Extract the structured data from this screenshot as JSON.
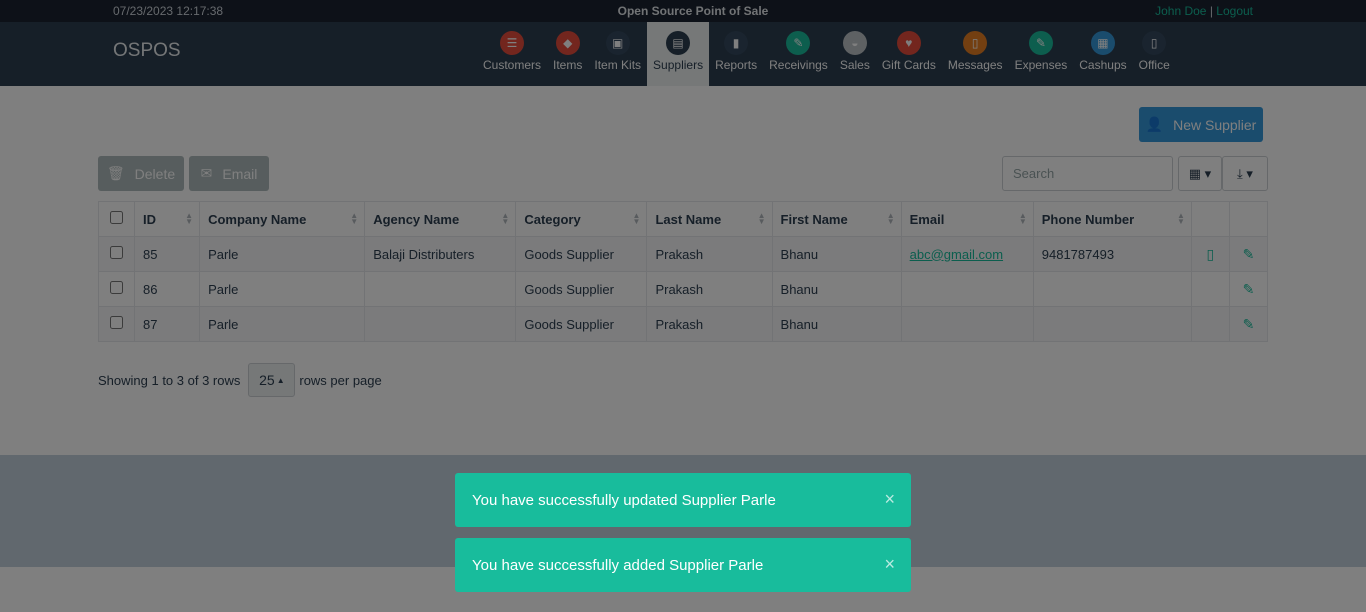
{
  "topbar": {
    "datetime": "07/23/2023 12:17:38",
    "app_title": "Open Source Point of Sale",
    "user": "John Doe",
    "separator": "|",
    "logout": "Logout"
  },
  "brand": "OSPOS",
  "nav": [
    {
      "label": "Customers",
      "icon": "customers-icon",
      "color": "#e74c3c",
      "glyph": "☰"
    },
    {
      "label": "Items",
      "icon": "items-tag-icon",
      "color": "#e74c3c",
      "glyph": "◆"
    },
    {
      "label": "Item Kits",
      "icon": "item-kits-icon",
      "color": "#34495e",
      "glyph": "▣"
    },
    {
      "label": "Suppliers",
      "icon": "suppliers-briefcase-icon",
      "color": "#2c3e50",
      "glyph": "▤"
    },
    {
      "label": "Reports",
      "icon": "reports-chart-icon",
      "color": "#34495e",
      "glyph": "▮"
    },
    {
      "label": "Receivings",
      "icon": "receivings-icon",
      "color": "#1abc9c",
      "glyph": "✎"
    },
    {
      "label": "Sales",
      "icon": "sales-basket-icon",
      "color": "#bdc3c7",
      "glyph": "◒"
    },
    {
      "label": "Gift Cards",
      "icon": "gift-cards-heart-icon",
      "color": "#e74c3c",
      "glyph": "♥"
    },
    {
      "label": "Messages",
      "icon": "messages-phone-icon",
      "color": "#e67e22",
      "glyph": "▯"
    },
    {
      "label": "Expenses",
      "icon": "expenses-icon",
      "color": "#1abc9c",
      "glyph": "✎"
    },
    {
      "label": "Cashups",
      "icon": "cashups-icon",
      "color": "#3498db",
      "glyph": "▦"
    },
    {
      "label": "Office",
      "icon": "office-door-icon",
      "color": "#34495e",
      "glyph": "▯"
    }
  ],
  "active_nav": "Suppliers",
  "toolbar": {
    "new_supplier": "New Supplier",
    "delete": "Delete",
    "email": "Email",
    "search_placeholder": "Search"
  },
  "table": {
    "columns": [
      "ID",
      "Company Name",
      "Agency Name",
      "Category",
      "Last Name",
      "First Name",
      "Email",
      "Phone Number"
    ],
    "rows": [
      {
        "id": "85",
        "company": "Parle",
        "agency": "Balaji Distributers",
        "category": "Goods Supplier",
        "last": "Prakash",
        "first": "Bhanu",
        "email": "abc@gmail.com",
        "phone": "9481787493",
        "has_mobile": true
      },
      {
        "id": "86",
        "company": "Parle",
        "agency": "",
        "category": "Goods Supplier",
        "last": "Prakash",
        "first": "Bhanu",
        "email": "",
        "phone": "",
        "has_mobile": false
      },
      {
        "id": "87",
        "company": "Parle",
        "agency": "",
        "category": "Goods Supplier",
        "last": "Prakash",
        "first": "Bhanu",
        "email": "",
        "phone": "",
        "has_mobile": false
      }
    ]
  },
  "pager": {
    "showing": "Showing 1 to 3 of 3 rows",
    "page_size": "25",
    "rows_per_page": "rows per page"
  },
  "toasts": [
    {
      "text": "You have successfully updated Supplier Parle",
      "close": "×"
    },
    {
      "text": "You have successfully added Supplier Parle",
      "close": "×"
    }
  ],
  "colors": {
    "accent": "#18bc9c",
    "navbar": "#2c3e50",
    "primary": "#3498db"
  }
}
